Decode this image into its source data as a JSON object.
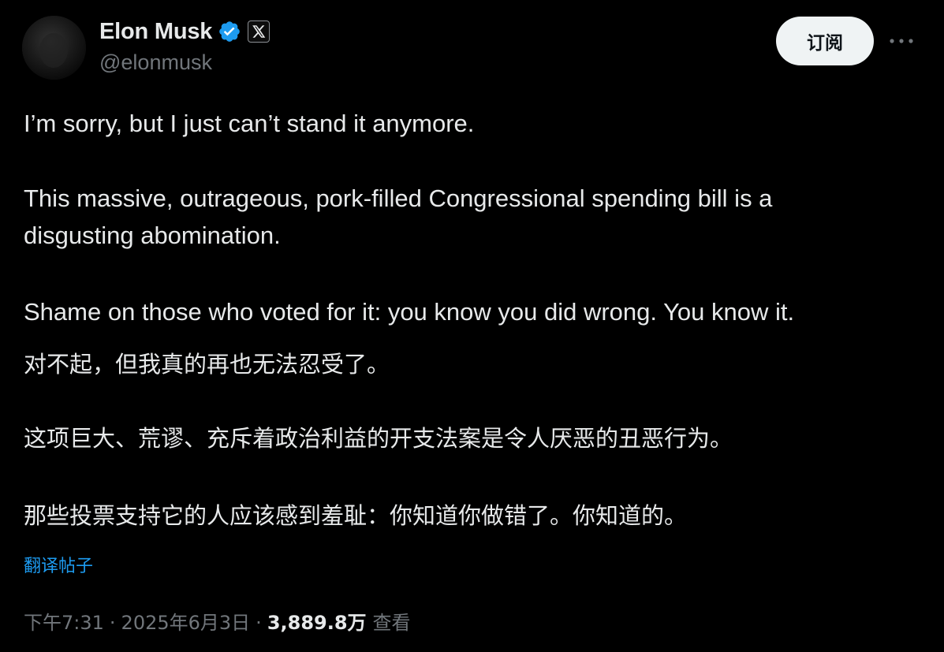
{
  "author": {
    "display_name": "Elon Musk",
    "handle": "@elonmusk",
    "verified": true,
    "affiliate_badge": "X"
  },
  "actions": {
    "subscribe_label": "订阅",
    "more_icon": "more-horizontal-icon"
  },
  "tweet": {
    "lines_en": [
      "I’m sorry, but I just can’t stand it anymore.",
      "This massive, outrageous, pork-filled Congressional spending bill is a",
      "disgusting abomination.",
      "Shame on those who voted for it: you know you did wrong. You know it."
    ],
    "lines_zh": [
      "对不起，但我真的再也无法忍受了。",
      "这项巨大、荒谬、充斥着政治利益的开支法案是令人厌恶的丑恶行为。",
      "那些投票支持它的人应该感到羞耻：你知道你做错了。你知道的。"
    ]
  },
  "translate_label": "翻译帖子",
  "meta": {
    "time": "下午7:31",
    "separator": "·",
    "date": "2025年6月3日",
    "views_count": "3,889.8万",
    "views_label": "查看"
  },
  "colors": {
    "background": "#000000",
    "text_primary": "#e7e9ea",
    "text_secondary": "#71767b",
    "link": "#1d9bf0",
    "verified": "#1d9bf0",
    "button_bg": "#eff3f4"
  }
}
